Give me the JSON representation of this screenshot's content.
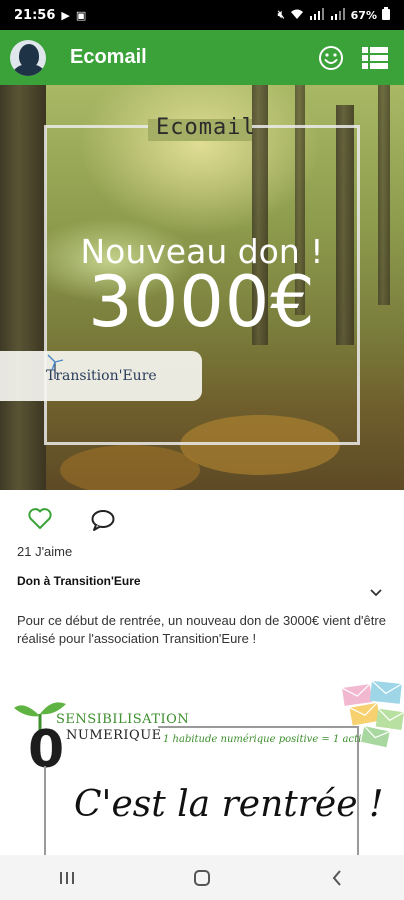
{
  "status_bar": {
    "time": "21:56",
    "battery": "67%"
  },
  "app_bar": {
    "title": "Ecomail",
    "icons": [
      "avatar",
      "smiley-icon",
      "list-icon"
    ]
  },
  "hero": {
    "brand": "Ecomail",
    "line1": "Nouveau don !",
    "line2": "3000€",
    "partner": "Transition'Eure"
  },
  "post": {
    "likes_text": "21 J'aime",
    "title": "Don à Transition'Eure",
    "body": "Pour ce début de rentrée, un nouveau don de 3000€ vient d'être réalisé pour l'association Transition'Eure !"
  },
  "next_card": {
    "zero": "0",
    "line_sensibilisation": "SENSIBILISATION",
    "line_numerique": "NUMERIQUE",
    "tagline": "1 habitude numérique positive = 1 action !",
    "headline": "C'est la rentrée !"
  },
  "colors": {
    "app_bar": "#3ba23a",
    "like_icon": "#3ba23a"
  },
  "nav_bar": {
    "icons": [
      "recent-apps-icon",
      "home-icon",
      "back-icon"
    ]
  }
}
